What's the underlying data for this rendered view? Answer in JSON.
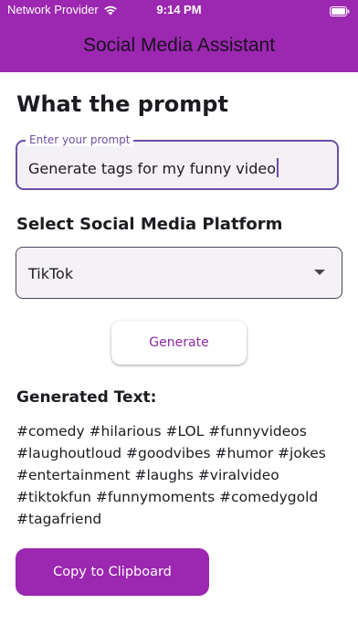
{
  "status_bar": {
    "carrier": "Network Provider",
    "time": "9:14 PM",
    "wifi_icon": "wifi-icon",
    "battery_icon": "battery-icon"
  },
  "app_bar": {
    "title": "Social Media Assistant",
    "background": "#9c27b0"
  },
  "prompt_section": {
    "heading": "What the prompt",
    "field_label": "Enter your prompt",
    "field_value": "Generate tags for my funny video"
  },
  "platform_section": {
    "heading": "Select Social Media Platform",
    "selected": "TikTok",
    "dropdown_icon": "dropdown-arrow-icon"
  },
  "actions": {
    "generate_label": "Generate",
    "copy_label": "Copy to Clipboard"
  },
  "result": {
    "heading": "Generated Text:",
    "lines": [
      "#comedy #hilarious #LOL #funnyvideos",
      "#laughoutloud #goodvibes #humor #jokes",
      "#entertainment #laughs #viralvideo",
      "#tiktokfun #funnymoments #comedygold",
      "#tagafriend"
    ]
  },
  "colors": {
    "primary": "#9c27b0",
    "focus": "#6d4fa3",
    "text": "#1d1b20"
  }
}
